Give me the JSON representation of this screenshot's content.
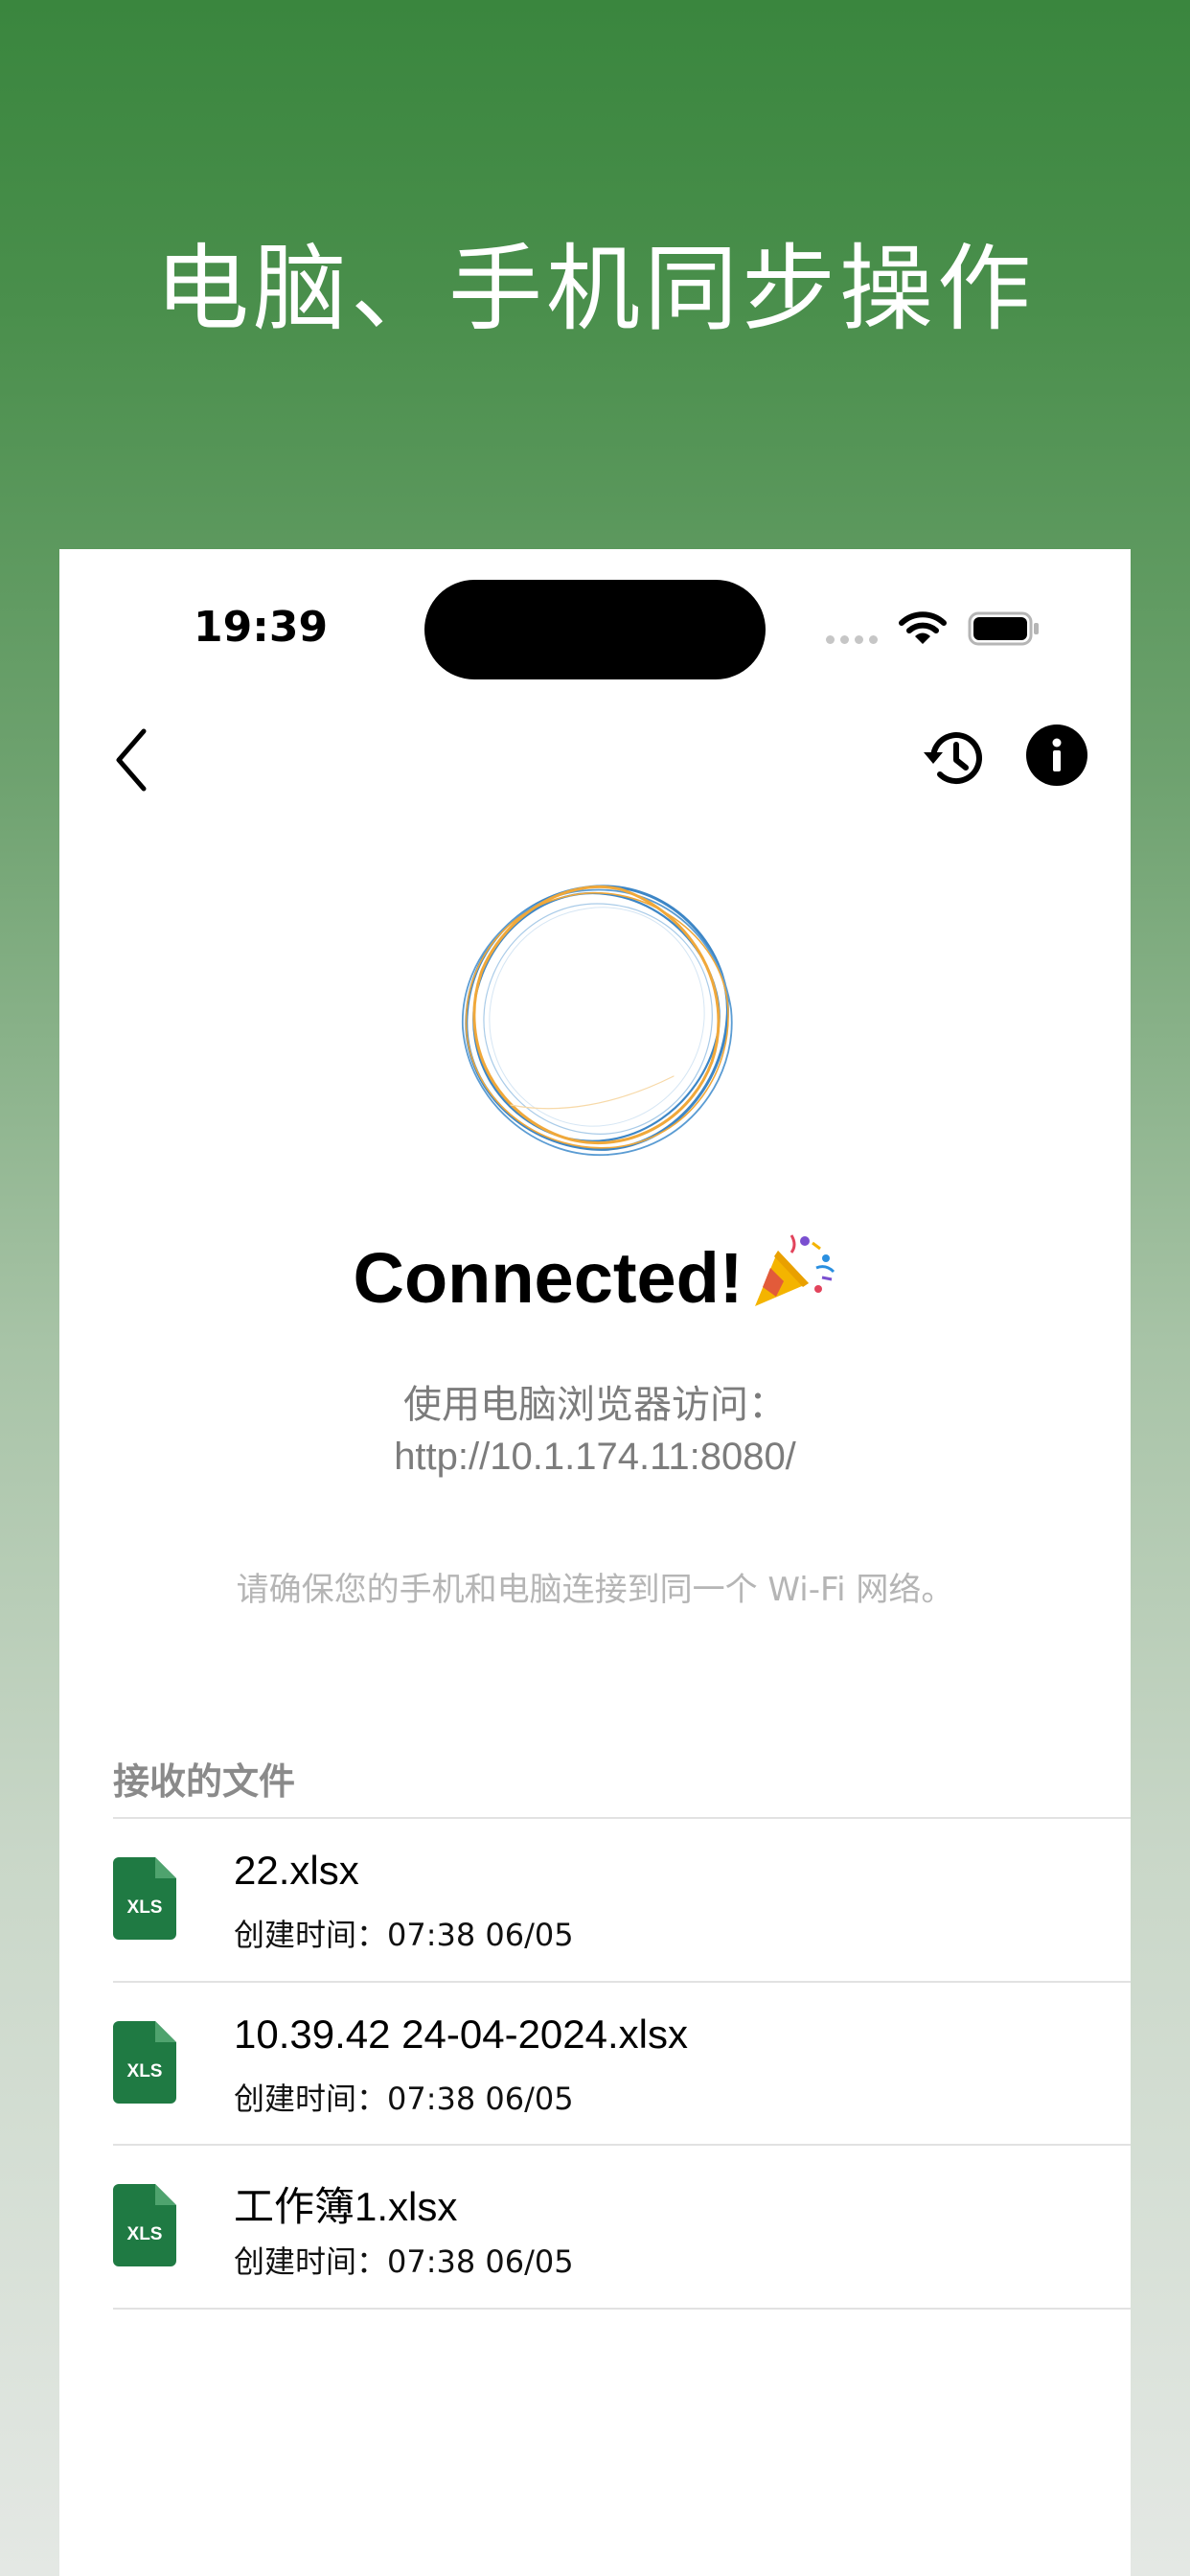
{
  "headline": "电脑、手机同步操作",
  "status_bar": {
    "time": "19:39"
  },
  "nav": {
    "back_icon": "chevron-left-icon",
    "history_icon": "history-icon",
    "info_icon": "info-icon"
  },
  "connection": {
    "status": "Connected!",
    "status_emoji_icon": "party-popper-icon",
    "visit_label": "使用电脑浏览器访问：",
    "url": "http://10.1.174.11:8080/",
    "wifi_note": "请确保您的手机和电脑连接到同一个 Wi-Fi 网络。"
  },
  "received_files": {
    "title": "接收的文件",
    "items": [
      {
        "name": "22.xlsx",
        "created": "创建时间：07:38 06/05",
        "icon_label": "XLS"
      },
      {
        "name": "10.39.42 24-04-2024.xlsx",
        "created": "创建时间：07:38 06/05",
        "icon_label": "XLS"
      },
      {
        "name": "工作簿1.xlsx",
        "created": "创建时间：07:38 06/05",
        "icon_label": "XLS"
      }
    ]
  },
  "colors": {
    "brand_green": "#3a863e",
    "excel_green": "#1f7a43",
    "orb_blue": "#3d86c6",
    "orb_orange": "#f0a83a"
  }
}
